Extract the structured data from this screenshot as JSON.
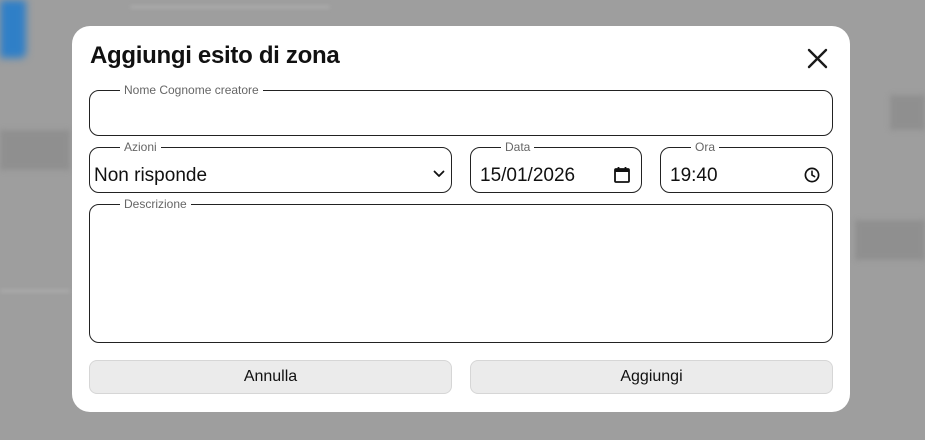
{
  "modal": {
    "title": "Aggiungi esito di zona",
    "close_icon": "close-icon"
  },
  "form": {
    "creator": {
      "label": "Nome Cognome creatore",
      "value": ""
    },
    "actions": {
      "label": "Azioni",
      "selected": "Non risponde",
      "icon": "chevron-down-icon"
    },
    "date": {
      "label": "Data",
      "value": "15/01/2026",
      "icon": "calendar-icon"
    },
    "time": {
      "label": "Ora",
      "value": "19:40",
      "icon": "clock-icon"
    },
    "description": {
      "label": "Descrizione",
      "value": ""
    }
  },
  "buttons": {
    "cancel_label": "Annulla",
    "submit_label": "Aggiungi"
  },
  "colors": {
    "backdrop": "#9e9e9e",
    "modal_bg": "#ffffff",
    "button_bg": "#ebebeb",
    "border": "#222222",
    "legend_text": "#666666"
  }
}
